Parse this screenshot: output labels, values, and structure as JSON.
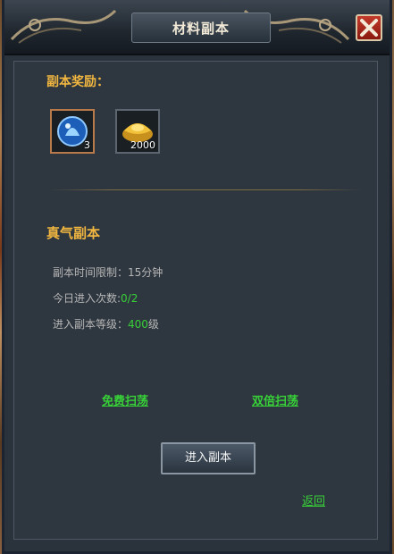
{
  "window": {
    "title": "材料副本"
  },
  "rewards": {
    "heading": "副本奖励：",
    "items": [
      {
        "icon": "blue-orb-icon",
        "count": "3"
      },
      {
        "icon": "gold-ingot-icon",
        "count": "2000"
      }
    ]
  },
  "dungeon": {
    "name": "真气副本",
    "time_limit_label": "副本时间限制：",
    "time_limit_value": "15分钟",
    "entries_label": "今日进入次数:",
    "entries_value": "0/2",
    "level_label": "进入副本等级：",
    "level_value": "400",
    "level_unit": "级"
  },
  "actions": {
    "free_sweep": "免费扫荡",
    "double_sweep": "双倍扫荡",
    "enter": "进入副本",
    "back": "返回"
  },
  "colors": {
    "accent": "#f0b640",
    "link": "#38d038",
    "panel": "#2e363f"
  }
}
